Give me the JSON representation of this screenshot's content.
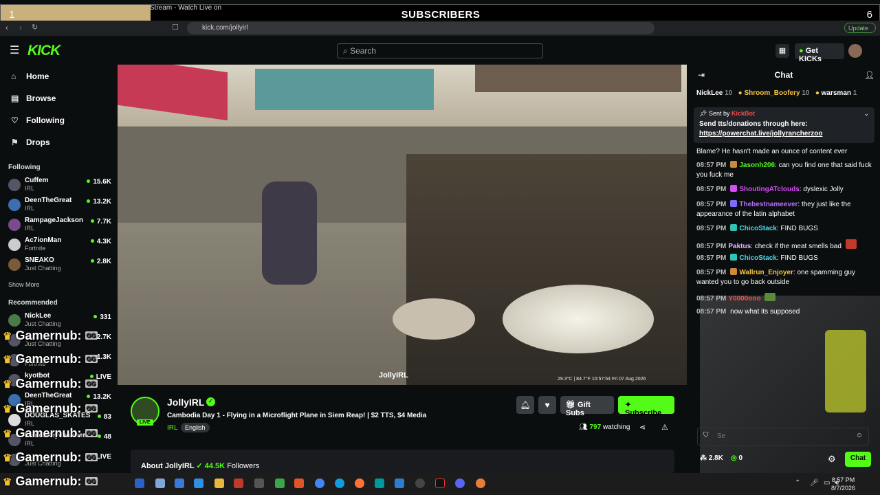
{
  "overlay": {
    "left_num": "1",
    "title": "SUBSCRIBERS",
    "right_num": "6"
  },
  "browser": {
    "tab_title": "Stream - Watch Live on",
    "url": "kick.com/jollyirl",
    "update_label": "Update"
  },
  "header": {
    "logo": "KICK",
    "search_placeholder": "Search",
    "getkicks_label": "Get KICKs"
  },
  "nav": [
    {
      "label": "Home"
    },
    {
      "label": "Browse"
    },
    {
      "label": "Following"
    },
    {
      "label": "Drops"
    }
  ],
  "following": {
    "heading": "Following",
    "channels": [
      {
        "name": "Cuffem",
        "category": "IRL",
        "viewers": "15.6K"
      },
      {
        "name": "DeenTheGreat",
        "category": "IRL",
        "viewers": "13.2K"
      },
      {
        "name": "RampageJackson",
        "category": "IRL",
        "viewers": "7.7K"
      },
      {
        "name": "Ac7ionMan",
        "category": "Fortnite",
        "viewers": "4.3K"
      },
      {
        "name": "SNEAKO",
        "category": "Just Chatting",
        "viewers": "2.8K"
      }
    ],
    "show_more": "Show More"
  },
  "recommended": {
    "heading": "Recommended",
    "channels": [
      {
        "name": "NickLee",
        "category": "Just Chatting",
        "viewers": "331"
      },
      {
        "name": "",
        "category": "Just Chatting",
        "viewers": "2.7K"
      },
      {
        "name": "",
        "category": "Fortnite",
        "viewers": "1.3K"
      },
      {
        "name": "kyotbot",
        "category": "",
        "viewers": "LIVE"
      },
      {
        "name": "DeenTheGreat",
        "category": "IRL",
        "viewers": "13.2K"
      },
      {
        "name": "DOUGLAS_SKATES",
        "category": "IRL",
        "viewers": "83"
      },
      {
        "name": "Lemonkeychanner",
        "category": "IRL",
        "viewers": "48"
      },
      {
        "name": "",
        "category": "Just Chatting",
        "viewers": "LIVE"
      }
    ]
  },
  "overlay_alert": {
    "text": "Gamernub:",
    "badge": "GG"
  },
  "video": {
    "watermark": "JollyIRL",
    "timestamp": "29.3°C | 84.7°F     10:57:54   Fri 07 Aug 2026"
  },
  "channel": {
    "name": "JollyIRL",
    "live_label": "LIVE",
    "stream_title": "Cambodia Day 1 - Flying in a Microflight Plane in Siem Reap! | $2 TTS, $4 Media",
    "category": "IRL",
    "language": "English",
    "gift_label": "Gift Subs",
    "subscribe_label": "Subscribe",
    "viewers": "797",
    "watching_label": "watching",
    "about_label": "About JollyIRL",
    "followers": "44.5K",
    "followers_label": "Followers"
  },
  "chat": {
    "title": "Chat",
    "gifters": [
      {
        "name": "NickLee",
        "count": "10"
      },
      {
        "name": "Shroom_Boofery",
        "count": "10"
      },
      {
        "name": "warsman",
        "count": "1"
      }
    ],
    "pinned": {
      "sent_by": "Sent by",
      "bot": "KickBot",
      "message": "Send tts/donations through here:",
      "link": "https://powerchat.live/jollyrancherzoo"
    },
    "messages": [
      {
        "time": "",
        "user": "",
        "color": "#ffffff",
        "badge": "",
        "text": "Blame? He hasn't made an ounce of content ever"
      },
      {
        "time": "08:57 PM",
        "user": "Jasonh206",
        "color": "#53fc18",
        "badge": "#c98a3a",
        "text": "can you find one that said fuck you fuck me"
      },
      {
        "time": "08:57 PM",
        "user": "ShoutingATclouds",
        "color": "#d54df5",
        "badge": "#2ec4b6",
        "text": "dyslexic Jolly"
      },
      {
        "time": "08:57 PM",
        "user": "Thebestnameever",
        "color": "#b56cff",
        "badge": "#7b6cff",
        "text": "they just like the appearance of the latin alphabet"
      },
      {
        "time": "08:57 PM",
        "user": "ChicoStack",
        "color": "#4dd9e8",
        "badge": "#2ec4b6",
        "text": "FIND BUGS"
      },
      {
        "time": "08:57 PM",
        "user": "Paktus",
        "color": "#e9b6ff",
        "badge": "",
        "text": "check if the meat smells bad"
      },
      {
        "time": "08:57 PM",
        "user": "ChicoStack",
        "color": "#4dd9e8",
        "badge": "#2ec4b6",
        "text": "FIND BUGS"
      },
      {
        "time": "08:57 PM",
        "user": "Wallrun_Enjoyer",
        "color": "#f4c542",
        "badge": "#c98a3a",
        "text": "one spamming guy wanted you to go back outside"
      },
      {
        "time": "08:57 PM",
        "user": "Y0000ooo",
        "color": "#ff4747",
        "badge": "",
        "text": ""
      },
      {
        "time": "08:57 PM",
        "user": "",
        "color": "#ffffff",
        "badge": "",
        "text": "now what its supposed"
      }
    ],
    "input_placeholder": "Se",
    "kicks_count": "2.8K",
    "points": "0",
    "chat_button": "Chat"
  },
  "taskbar": {
    "time": "8:57 PM",
    "date": "8/7/2026"
  },
  "colors": {
    "brand": "#53fc18",
    "bg": "#0b0e0f"
  }
}
